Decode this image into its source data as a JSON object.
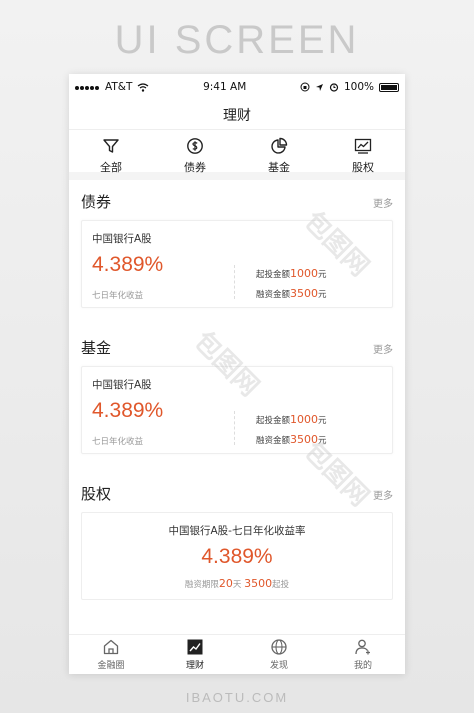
{
  "banner": "UI SCREEN",
  "status": {
    "carrier": "AT&T",
    "time": "9:41 AM",
    "battery": "100%"
  },
  "title": "理财",
  "categories": [
    {
      "label": "全部",
      "icon": "filter-icon"
    },
    {
      "label": "债券",
      "icon": "dollar-circle-icon"
    },
    {
      "label": "基金",
      "icon": "pie-chart-icon"
    },
    {
      "label": "股权",
      "icon": "line-chart-icon"
    }
  ],
  "more": "更多",
  "sections": [
    {
      "title": "债券",
      "card": {
        "name": "中国银行A股",
        "rate": "4.389%",
        "desc": "七日年化收益",
        "start_label": "起投金额",
        "start_value": "1000",
        "start_unit": "元",
        "fin_label": "融资金额",
        "fin_value": "3500",
        "fin_unit": "元"
      }
    },
    {
      "title": "基金",
      "card": {
        "name": "中国银行A股",
        "rate": "4.389%",
        "desc": "七日年化收益",
        "start_label": "起投金额",
        "start_value": "1000",
        "start_unit": "元",
        "fin_label": "融资金额",
        "fin_value": "3500",
        "fin_unit": "元"
      }
    },
    {
      "title": "股权",
      "card": {
        "name": "中国银行A股-七日年化收益率",
        "rate": "4.389%",
        "period_label": "融资期限",
        "period_value": "20",
        "period_unit": "天",
        "min_value": "3500",
        "min_unit": "起投"
      }
    }
  ],
  "tabs": [
    {
      "label": "金融圈",
      "icon": "home-icon"
    },
    {
      "label": "理财",
      "icon": "chart-icon",
      "active": true
    },
    {
      "label": "发现",
      "icon": "globe-icon"
    },
    {
      "label": "我的",
      "icon": "user-icon"
    }
  ],
  "watermark": "包图网",
  "footer": "IBAOTU.COM"
}
